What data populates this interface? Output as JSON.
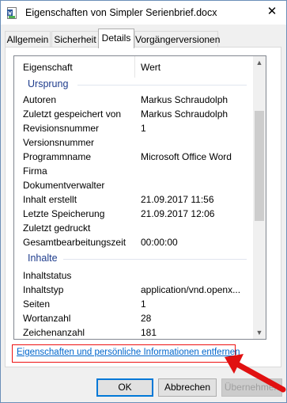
{
  "window": {
    "title": "Eigenschaften von Simpler Serienbrief.docx",
    "close_glyph": "✕"
  },
  "tabs": [
    {
      "label": "Allgemein",
      "active": false
    },
    {
      "label": "Sicherheit",
      "active": false
    },
    {
      "label": "Details",
      "active": true
    },
    {
      "label": "Vorgängerversionen",
      "active": false
    }
  ],
  "list": {
    "header": {
      "property": "Eigenschaft",
      "value": "Wert"
    },
    "groups": {
      "origin": "Ursprung",
      "content": "Inhalte"
    },
    "rows": [
      {
        "property": "Autoren",
        "value": "Markus Schraudolph"
      },
      {
        "property": "Zuletzt gespeichert von",
        "value": "Markus Schraudolph"
      },
      {
        "property": "Revisionsnummer",
        "value": "1"
      },
      {
        "property": "Versionsnummer",
        "value": ""
      },
      {
        "property": "Programmname",
        "value": "Microsoft Office Word"
      },
      {
        "property": "Firma",
        "value": ""
      },
      {
        "property": "Dokumentverwalter",
        "value": ""
      },
      {
        "property": "Inhalt erstellt",
        "value": "21.09.2017 11:56"
      },
      {
        "property": "Letzte Speicherung",
        "value": "21.09.2017 12:06"
      },
      {
        "property": "Zuletzt gedruckt",
        "value": ""
      },
      {
        "property": "Gesamtbearbeitungszeit",
        "value": "00:00:00"
      },
      {
        "property": "Inhaltstatus",
        "value": ""
      },
      {
        "property": "Inhaltstyp",
        "value": "application/vnd.openx..."
      },
      {
        "property": "Seiten",
        "value": "1"
      },
      {
        "property": "Wortanzahl",
        "value": "28"
      },
      {
        "property": "Zeichenanzahl",
        "value": "181"
      }
    ]
  },
  "scrollbar": {
    "up_glyph": "▲",
    "down_glyph": "▼"
  },
  "link": {
    "label": "Eigenschaften und persönliche Informationen entfernen"
  },
  "buttons": {
    "ok": "OK",
    "cancel": "Abbrechen",
    "apply": "Übernehmen"
  },
  "colors": {
    "accent": "#0078d7",
    "group_text": "#1e3c8c",
    "highlight": "#e11111",
    "link": "#0066cc"
  }
}
